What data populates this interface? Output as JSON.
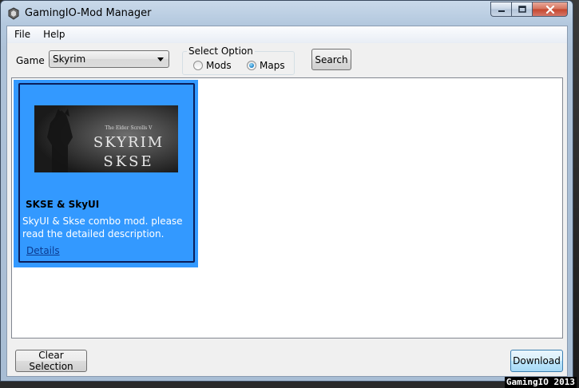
{
  "window": {
    "title": "GamingIO-Mod Manager"
  },
  "menu": {
    "items": [
      "File",
      "Help"
    ]
  },
  "toolbar": {
    "game_label": "Game",
    "game_selected": "Skyrim",
    "option_legend": "Select Option",
    "option_mods": "Mods",
    "option_maps": "Maps",
    "selected_option": "Maps",
    "search_label": "Search"
  },
  "mods": [
    {
      "thumb_subtitle": "The Elder Scrolls V",
      "thumb_line1": "SKYRIM",
      "thumb_line2": "SKSE",
      "title": "SKSE & SkyUI",
      "description": "SkyUI & Skse combo mod. please read the detailed description.",
      "link": "Details"
    }
  ],
  "footer": {
    "clear_label": "Clear Selection",
    "download_label": "Download"
  },
  "watermark": "GamingIO 2013",
  "colors": {
    "selection_blue": "#3399ff",
    "card_border": "#0b1e5a",
    "link": "#0b3a8f"
  },
  "icons": {
    "app": "app-icon",
    "minimize": "minimize-icon",
    "maximize": "maximize-icon",
    "close": "close-icon",
    "dropdown": "chevron-down-icon"
  }
}
